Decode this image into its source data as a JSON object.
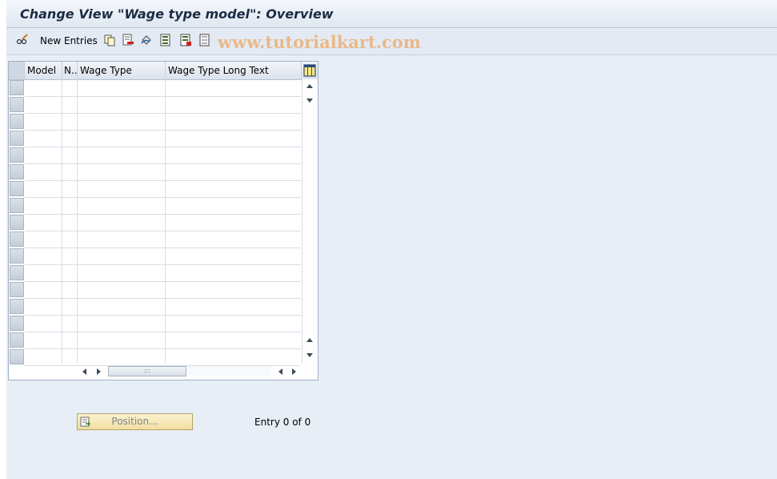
{
  "window": {
    "title": "Change View \"Wage type model\": Overview"
  },
  "toolbar": {
    "new_entries_label": "New Entries",
    "icons": [
      "glasses-pencil-icon",
      "copy-icon",
      "delete-icon",
      "undo-icon",
      "select-all-icon",
      "select-block-icon",
      "deselect-all-icon"
    ]
  },
  "watermark": "www.tutorialkart.com",
  "table": {
    "columns": [
      "Model",
      "N..",
      "Wage Type",
      "Wage Type Long Text"
    ],
    "visible_rows": 17,
    "rows": []
  },
  "footer": {
    "position_label": "Position...",
    "entry_status": "Entry 0 of 0"
  },
  "colors": {
    "background": "#e8eef6",
    "position_button": "#f5e6b0",
    "watermark": "#e9b989"
  }
}
